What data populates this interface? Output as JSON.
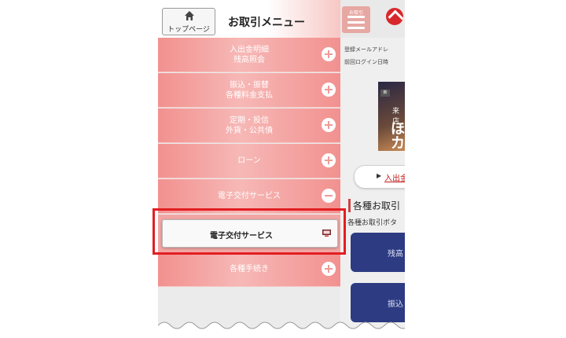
{
  "menu": {
    "top_button_label": "トップページ",
    "title": "お取引メニュー",
    "items": [
      {
        "line1": "入出金明細",
        "line2": "残高照会",
        "icon": "plus-icon"
      },
      {
        "line1": "振込・振替",
        "line2": "各種料金支払",
        "icon": "plus-icon"
      },
      {
        "line1": "定期・投信",
        "line2": "外貨・公共債",
        "icon": "plus-icon"
      },
      {
        "line1": "ローン",
        "line2": "",
        "icon": "plus-icon"
      },
      {
        "line1": "電子交付サービス",
        "line2": "",
        "icon": "minus-icon"
      },
      {
        "line1": "各種手続き",
        "line2": "",
        "icon": "plus-icon"
      }
    ],
    "submenu_item": {
      "label": "電子交付サービス",
      "icon": "document-icon"
    }
  },
  "background": {
    "hamburger_caption": "お取引",
    "info_line1": "登録メールアドレ",
    "info_line2": "前回ログイン日時",
    "banner_tag": "新",
    "banner_text1": "来店",
    "banner_text2": "ほ",
    "banner_text3": "カ",
    "link_label": "入出金",
    "section_title": "各種お取引",
    "section_sub": "各種お取引ボタ",
    "button1": "残高",
    "button2": "振込"
  },
  "colors": {
    "menu_item": "#f2918f",
    "highlight": "#e21e22",
    "navy": "#2d3b83"
  }
}
